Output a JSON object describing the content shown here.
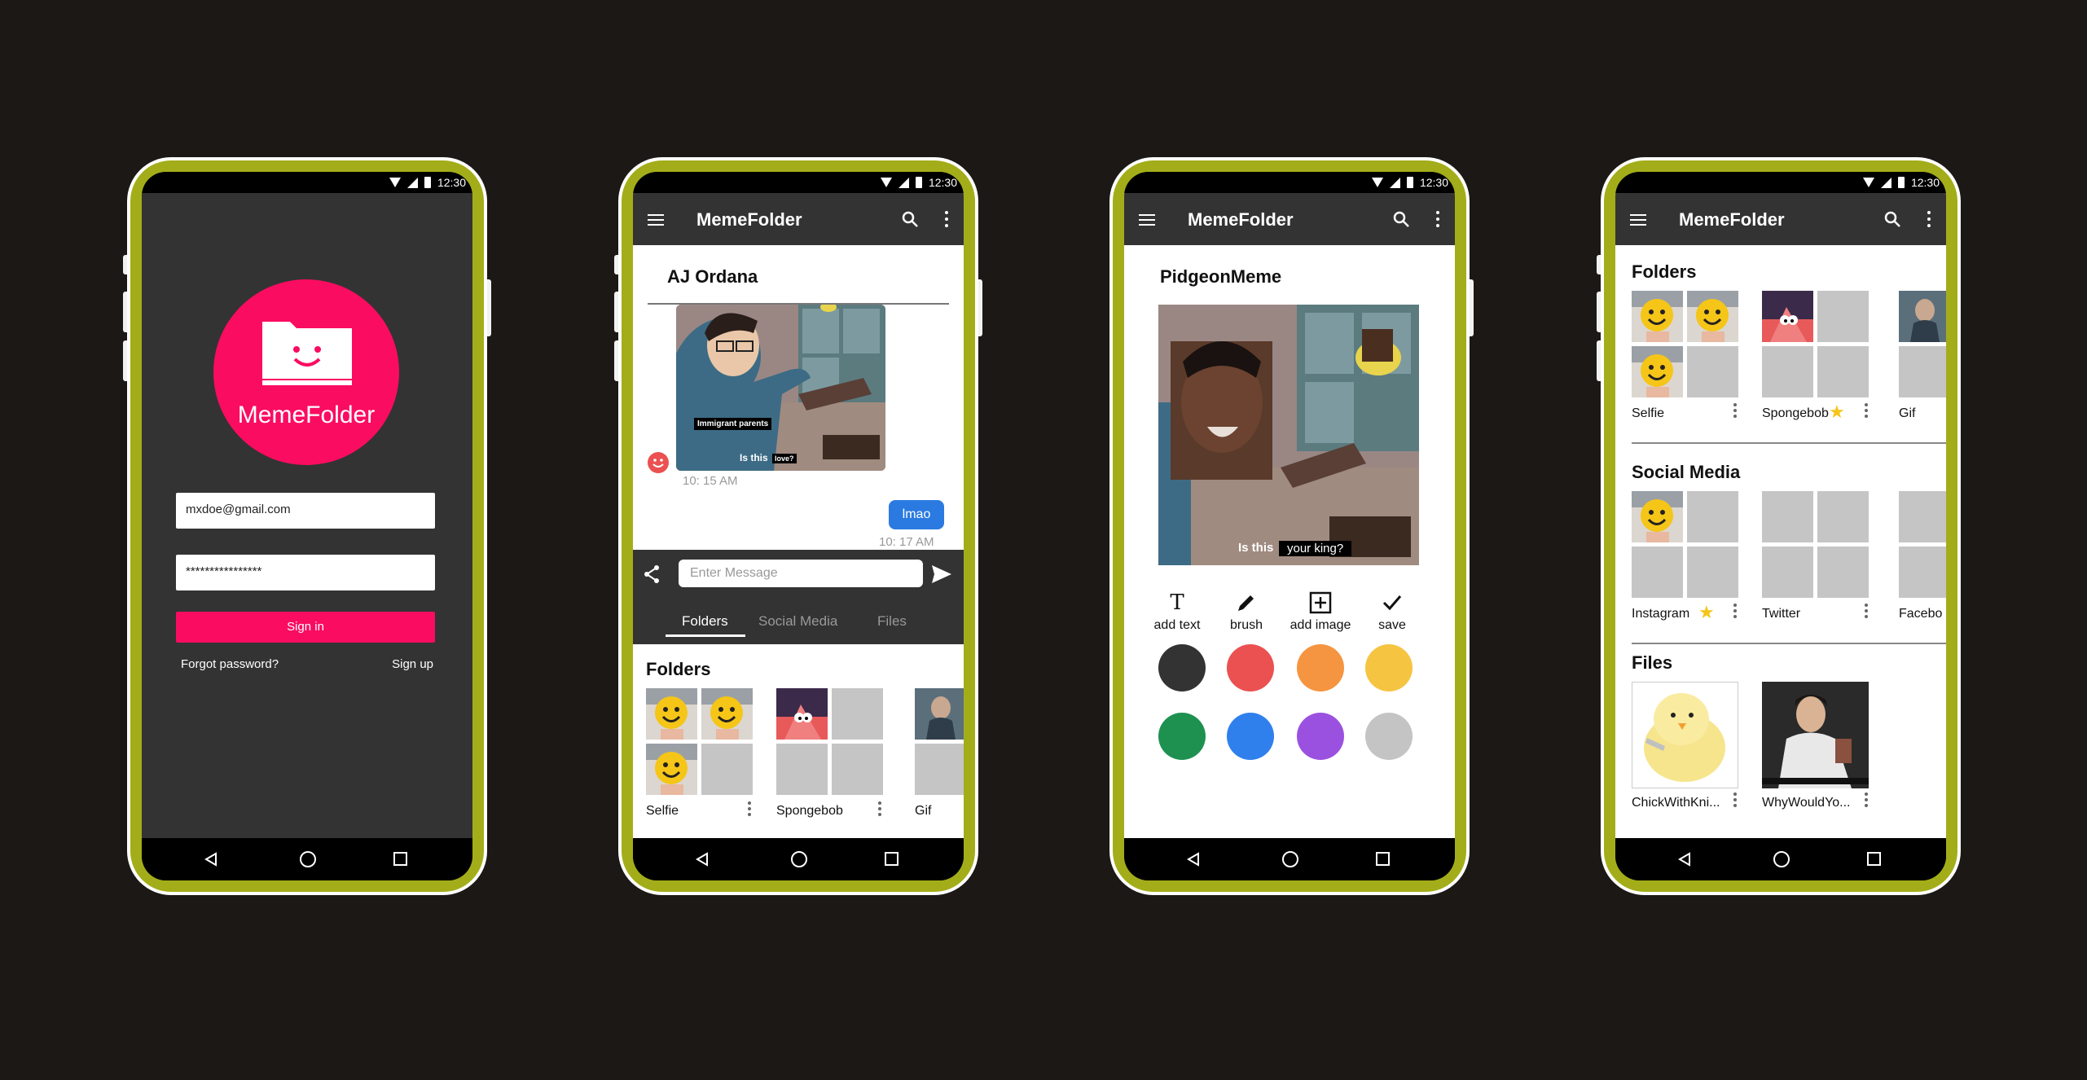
{
  "status": {
    "time": "12:30"
  },
  "app": {
    "title": "MemeFolder"
  },
  "login": {
    "logo_text": "MemeFolder",
    "email_value": "mxdoe@gmail.com",
    "password_value": "****************",
    "signin_label": "Sign in",
    "forgot_label": "Forgot password?",
    "signup_label": "Sign up"
  },
  "chat": {
    "contact_name": "AJ Ordana",
    "meme_caption_1": "Immigrant parents",
    "meme_caption_2": "Is this",
    "meme_caption_3": "love?",
    "time_received": "10: 15 AM",
    "sent_message": "lmao",
    "time_sent": "10: 17 AM",
    "input_placeholder": "Enter Message",
    "tabs": [
      "Folders",
      "Social Media",
      "Files"
    ],
    "active_tab": "Folders",
    "folders_title": "Folders",
    "folders": [
      {
        "label": "Selfie"
      },
      {
        "label": "Spongebob"
      },
      {
        "label": "Gif"
      }
    ]
  },
  "editor": {
    "meme_name": "PidgeonMeme",
    "caption_left": "Is this",
    "caption_right": "your king?",
    "tools": [
      {
        "label": "add text",
        "icon": "text-icon"
      },
      {
        "label": "brush",
        "icon": "brush-icon"
      },
      {
        "label": "add image",
        "icon": "add-image-icon"
      },
      {
        "label": "save",
        "icon": "check-icon"
      }
    ],
    "colors": [
      "#333333",
      "#eb5151",
      "#f59541",
      "#f5c542",
      "#1e9150",
      "#2f80ed",
      "#9b51e0",
      "#c4c4c4"
    ]
  },
  "browser": {
    "folders_title": "Folders",
    "folders": [
      {
        "label": "Selfie",
        "starred": false
      },
      {
        "label": "Spongebob",
        "starred": true
      },
      {
        "label": "Gif",
        "starred": false
      }
    ],
    "social_title": "Social Media",
    "social": [
      {
        "label": "Instagram",
        "starred": true
      },
      {
        "label": "Twitter",
        "starred": false
      },
      {
        "label": "Facebo",
        "starred": false
      }
    ],
    "files_title": "Files",
    "files": [
      {
        "label": "ChickWithKni..."
      },
      {
        "label": "WhyWouldYo..."
      }
    ]
  },
  "accent_color": "#fa0c61",
  "frame_color": "#a3ad19"
}
